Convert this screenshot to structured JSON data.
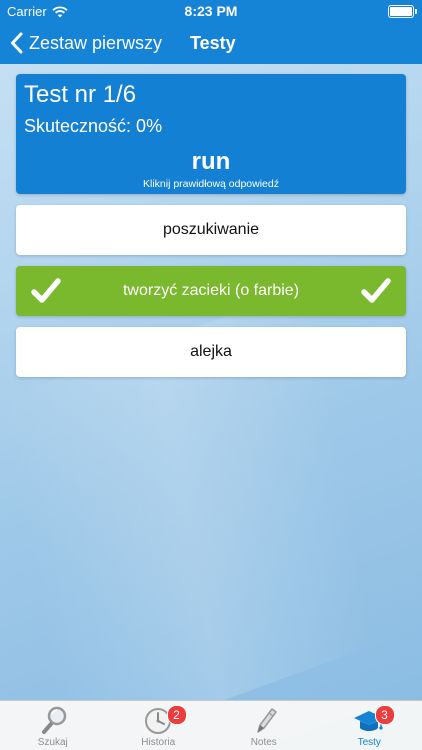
{
  "status_bar": {
    "carrier": "Carrier",
    "time": "8:23 PM"
  },
  "nav": {
    "back_label": "Zestaw pierwszy",
    "title": "Testy"
  },
  "test": {
    "title": "Test nr 1/6",
    "score": "Skuteczność: 0%",
    "word": "run",
    "hint": "Kliknij prawidłową odpowiedź"
  },
  "answers": [
    {
      "text": "poszukiwanie",
      "correct": false
    },
    {
      "text": "tworzyć zacieki (o farbie)",
      "correct": true
    },
    {
      "text": "alejka",
      "correct": false
    }
  ],
  "tabs": [
    {
      "label": "Szukaj",
      "icon": "magnifier-icon",
      "badge": ""
    },
    {
      "label": "Historia",
      "icon": "clock-icon",
      "badge": "2"
    },
    {
      "label": "Notes",
      "icon": "pen-icon",
      "badge": ""
    },
    {
      "label": "Testy",
      "icon": "graduation-cap-icon",
      "badge": "3",
      "active": true
    }
  ],
  "colors": {
    "nav_blue": "#1583d6",
    "card_blue": "#1480d4",
    "correct_green": "#7ab82d",
    "badge_red": "#ee3b3b"
  }
}
